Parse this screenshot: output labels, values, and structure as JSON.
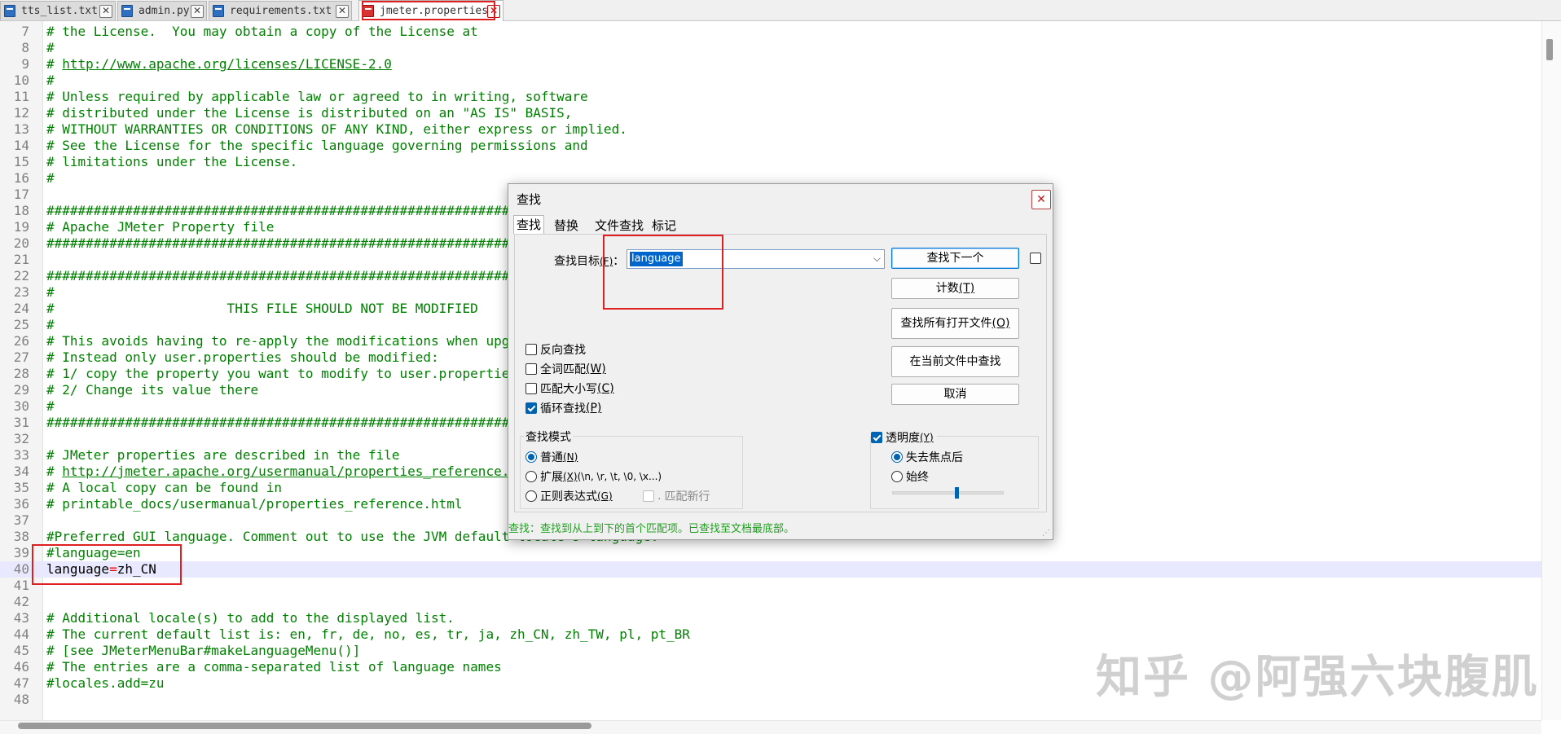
{
  "tabs": [
    {
      "name": "tts_list.txt"
    },
    {
      "name": "admin.py"
    },
    {
      "name": "requirements.txt"
    },
    {
      "name": "jmeter.properties"
    }
  ],
  "tab_close_glyph": "✕",
  "editor": {
    "lines": [
      {
        "n": "7",
        "text": "# the License.  You may obtain a copy of the License at"
      },
      {
        "n": "8",
        "text": "#"
      },
      {
        "n": "9",
        "pre": "# ",
        "url": "http://www.apache.org/licenses/LICENSE-2.0",
        "post": ""
      },
      {
        "n": "10",
        "text": "#"
      },
      {
        "n": "11",
        "text": "# Unless required by applicable law or agreed to in writing, software"
      },
      {
        "n": "12",
        "text": "# distributed under the License is distributed on an \"AS IS\" BASIS,"
      },
      {
        "n": "13",
        "text": "# WITHOUT WARRANTIES OR CONDITIONS OF ANY KIND, either express or implied."
      },
      {
        "n": "14",
        "text": "# See the License for the specific language governing permissions and"
      },
      {
        "n": "15",
        "text": "# limitations under the License."
      },
      {
        "n": "16",
        "text": "#"
      },
      {
        "n": "17",
        "text": ""
      },
      {
        "n": "18",
        "text": "################################################################################"
      },
      {
        "n": "19",
        "text": "# Apache JMeter Property file"
      },
      {
        "n": "20",
        "text": "################################################################################"
      },
      {
        "n": "21",
        "text": ""
      },
      {
        "n": "22",
        "text": "################################################################################"
      },
      {
        "n": "23",
        "text": "#"
      },
      {
        "n": "24",
        "text": "#                      THIS FILE SHOULD NOT BE MODIFIED"
      },
      {
        "n": "25",
        "text": "#"
      },
      {
        "n": "26",
        "text": "# This avoids having to re-apply the modifications when upgrading JMeter"
      },
      {
        "n": "27",
        "text": "# Instead only user.properties should be modified:"
      },
      {
        "n": "28",
        "text": "# 1/ copy the property you want to modify to user.properties from jmeter.properties"
      },
      {
        "n": "29",
        "text": "# 2/ Change its value there"
      },
      {
        "n": "30",
        "text": "#"
      },
      {
        "n": "31",
        "text": "################################################################################"
      },
      {
        "n": "32",
        "text": ""
      },
      {
        "n": "33",
        "text": "# JMeter properties are described in the file"
      },
      {
        "n": "34",
        "pre": "# ",
        "url": "http://jmeter.apache.org/usermanual/properties_reference.html",
        "post": ""
      },
      {
        "n": "35",
        "text": "# A local copy can be found in"
      },
      {
        "n": "36",
        "text": "# printable_docs/usermanual/properties_reference.html"
      },
      {
        "n": "37",
        "text": ""
      },
      {
        "n": "38",
        "text": "#Preferred GUI language. Comment out to use the JVM default locale's language."
      },
      {
        "n": "39",
        "text": "#language=en"
      },
      {
        "n": "40",
        "key": "language",
        "eq": "=",
        "val": "zh_CN",
        "current": true
      },
      {
        "n": "41",
        "text": ""
      },
      {
        "n": "42",
        "text": ""
      },
      {
        "n": "43",
        "text": "# Additional locale(s) to add to the displayed list."
      },
      {
        "n": "44",
        "text": "# The current default list is: en, fr, de, no, es, tr, ja, zh_CN, zh_TW, pl, pt_BR"
      },
      {
        "n": "45",
        "text": "# [see JMeterMenuBar#makeLanguageMenu()]"
      },
      {
        "n": "46",
        "text": "# The entries are a comma-separated list of language names"
      },
      {
        "n": "47",
        "text": "#locales.add=zu"
      },
      {
        "n": "48",
        "text": ""
      }
    ]
  },
  "watermark": "知乎 @阿强六块腹肌",
  "find_dialog": {
    "title": "查找",
    "close_glyph": "✕",
    "tabs": [
      "查找",
      "替换",
      "文件查找",
      "标记"
    ],
    "target_label": "查找目标",
    "target_hotkey": "(F)",
    "target_colon": "：",
    "target_value": "language",
    "dropdown_glyph": "⌵",
    "buttons": {
      "find_next": "查找下一个",
      "count": "计数",
      "count_key": "(T)",
      "find_all_open": "查找所有打开文件",
      "find_all_open_key": "(O)",
      "find_in_current": "在当前文件中查找",
      "cancel": "取消"
    },
    "options": [
      {
        "label": "反向查找",
        "key": "",
        "checked": false
      },
      {
        "label": "全词匹配",
        "key": "(W)",
        "checked": false
      },
      {
        "label": "匹配大小写",
        "key": "(C)",
        "checked": false
      },
      {
        "label": "循环查找",
        "key": "(P)",
        "checked": true
      }
    ],
    "mode": {
      "title": "查找模式",
      "normal": "普通",
      "normal_key": "(N)",
      "extended": "扩展",
      "extended_key": "(X)",
      "extended_hint": " (\\n, \\r, \\t, \\0, \\x...)",
      "regex": "正则表达式",
      "regex_key": "(G)",
      "match_newline": "匹配新行",
      "match_newline_prefix": ".",
      "selected": "normal"
    },
    "transparency": {
      "label": "透明度",
      "key": "(Y)",
      "enabled": true,
      "on_lose_focus": "失去焦点后",
      "always": "始终",
      "selected": "on_lose_focus",
      "level": 0.58
    },
    "status": "查找：查找到从上到下的首个匹配项。已查找至文档最底部。"
  },
  "colors": {
    "comment": "#008000",
    "highlight_box": "#e02020",
    "current_line": "#e8e8ff",
    "selection": "#0066cc",
    "status_text": "#20a020"
  }
}
